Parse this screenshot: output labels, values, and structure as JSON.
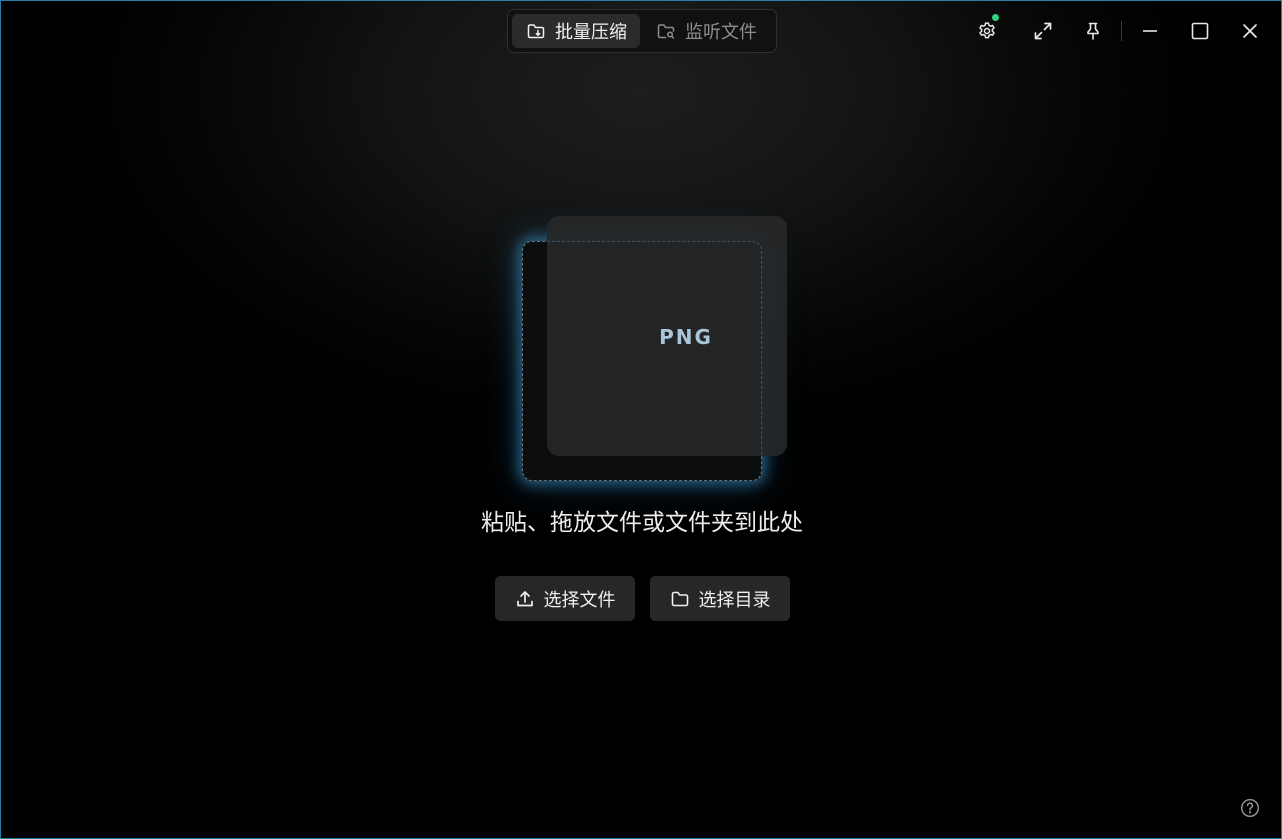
{
  "tabs": [
    {
      "label": "批量压缩",
      "icon": "folder-compress-icon",
      "active": true
    },
    {
      "label": "监听文件",
      "icon": "folder-search-icon",
      "active": false
    }
  ],
  "window_controls": {
    "settings_icon": "gear-icon",
    "settings_status_color": "#35d07f",
    "expand_icon": "expand-icon",
    "pin_icon": "pin-icon",
    "minimize_icon": "minimize-icon",
    "maximize_icon": "maximize-icon",
    "close_icon": "close-icon"
  },
  "drop_zone": {
    "format_label": "PNG",
    "hint": "粘贴、拖放文件或文件夹到此处",
    "glow_color": "#46aae6"
  },
  "actions": {
    "select_files": {
      "label": "选择文件",
      "icon": "upload-icon"
    },
    "select_folder": {
      "label": "选择目录",
      "icon": "folder-icon"
    }
  },
  "help_icon": "help-circle-icon"
}
